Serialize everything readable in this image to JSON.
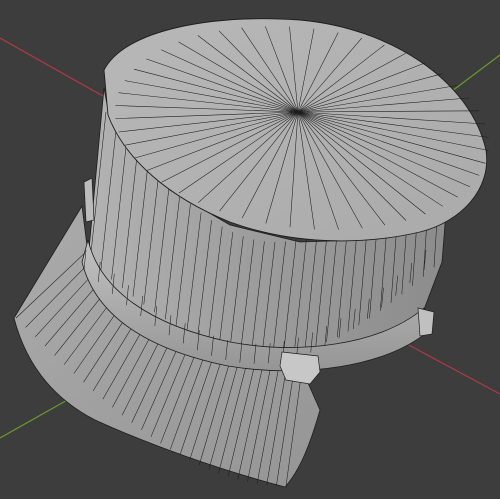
{
  "viewport": {
    "background": "#3d3d3d",
    "axes": {
      "x_axis_color": "#b03a45",
      "y_axis_color": "#6a9a2a"
    },
    "object": {
      "name": "cap",
      "kind": "mesh",
      "shading": "solid",
      "show_wireframe": true,
      "surface_color": "#a9a9a9",
      "wire_color": "#1e1e1e",
      "top_segments": 48,
      "side_segments": 32,
      "brim_segments": 28
    }
  }
}
